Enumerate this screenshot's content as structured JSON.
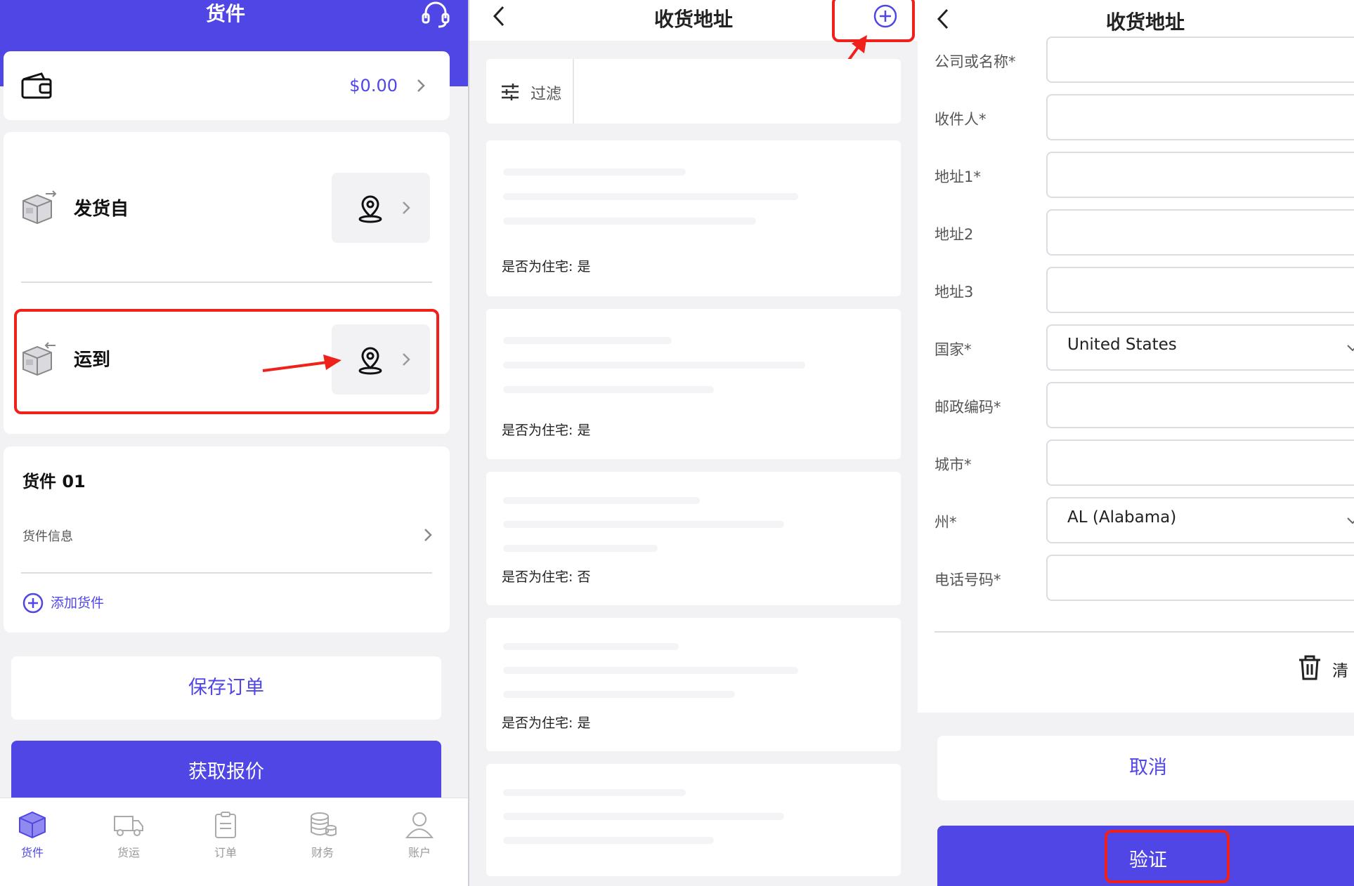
{
  "colors": {
    "accent": "#4f46e5",
    "annotation": "#f0201a",
    "background": "#f2f2f5"
  },
  "panel1": {
    "title": "货件",
    "wallet": {
      "amount": "$0.00"
    },
    "ship_from": {
      "label": "发货自"
    },
    "ship_to": {
      "label": "运到"
    },
    "cargo": {
      "title": "货件 01",
      "info_label": "货件信息",
      "add_label": "添加货件"
    },
    "save_button": "保存订单",
    "quote_button": "获取报价",
    "tabs": [
      {
        "label": "货件",
        "icon": "package-icon",
        "active": true
      },
      {
        "label": "货运",
        "icon": "truck-icon",
        "active": false
      },
      {
        "label": "订单",
        "icon": "clipboard-icon",
        "active": false
      },
      {
        "label": "财务",
        "icon": "coins-icon",
        "active": false
      },
      {
        "label": "账户",
        "icon": "user-icon",
        "active": false
      }
    ]
  },
  "panel2": {
    "title": "收货地址",
    "filter_label": "过滤",
    "addresses": [
      {
        "residential": "是否为住宅: 是"
      },
      {
        "residential": "是否为住宅: 是"
      },
      {
        "residential": "是否为住宅: 否"
      },
      {
        "residential": "是否为住宅: 是"
      }
    ]
  },
  "panel3": {
    "title": "收货地址",
    "fields": [
      {
        "label": "公司或名称*",
        "value": ""
      },
      {
        "label": "收件人*",
        "value": ""
      },
      {
        "label": "地址1*",
        "value": ""
      },
      {
        "label": "地址2",
        "value": ""
      },
      {
        "label": "地址3",
        "value": ""
      },
      {
        "label": "国家*",
        "value": "United States"
      },
      {
        "label": "邮政编码*",
        "value": ""
      },
      {
        "label": "城市*",
        "value": ""
      },
      {
        "label": "州*",
        "value": "AL (Alabama)"
      },
      {
        "label": "电话号码*",
        "value": ""
      }
    ],
    "clear_label": "清",
    "cancel_button": "取消",
    "verify_button": "验证"
  }
}
